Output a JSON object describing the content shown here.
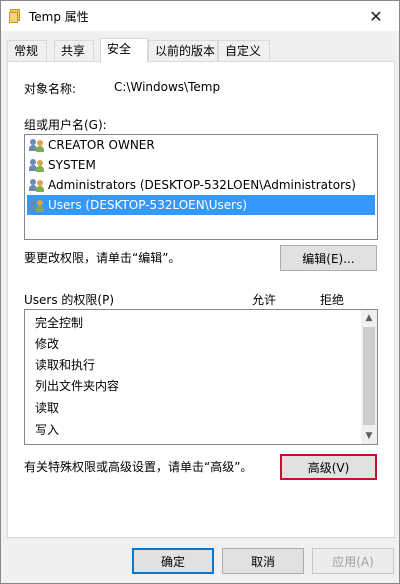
{
  "window": {
    "title": "Temp 属性",
    "close_glyph": "✕"
  },
  "tabs": [
    {
      "label": "常规",
      "active": false
    },
    {
      "label": "共享",
      "active": false
    },
    {
      "label": "安全",
      "active": true
    },
    {
      "label": "以前的版本",
      "active": false
    },
    {
      "label": "自定义",
      "active": false
    }
  ],
  "security": {
    "object_name_label": "对象名称:",
    "object_name_value": "C:\\Windows\\Temp",
    "group_label": "组或用户名(G):",
    "users": [
      {
        "name": "CREATOR OWNER",
        "selected": false
      },
      {
        "name": "SYSTEM",
        "selected": false
      },
      {
        "name": "Administrators (DESKTOP-532LOEN\\Administrators)",
        "selected": false
      },
      {
        "name": "Users (DESKTOP-532LOEN\\Users)",
        "selected": true
      }
    ],
    "change_hint": "要更改权限，请单击“编辑”。",
    "edit_button": "编辑(E)...",
    "perm_label": "Users 的权限(P)",
    "allow_header": "允许",
    "deny_header": "拒绝",
    "permissions": [
      "完全控制",
      "修改",
      "读取和执行",
      "列出文件夹内容",
      "读取",
      "写入"
    ],
    "advanced_hint": "有关特殊权限或高级设置，请单击“高级”。",
    "advanced_button": "高级(V)"
  },
  "footer": {
    "ok_button": "确定",
    "cancel_button": "取消",
    "apply_button": "应用(A)"
  },
  "colors": {
    "selection": "#3399ff",
    "highlight_border": "#c8102e"
  }
}
